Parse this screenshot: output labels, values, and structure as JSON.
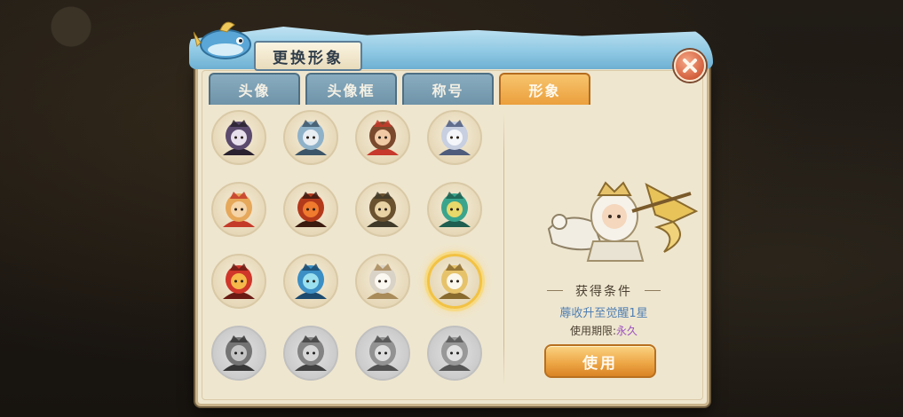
{
  "dialog": {
    "title": "更换形象"
  },
  "tabs": [
    {
      "label": "头像",
      "active": false
    },
    {
      "label": "头像框",
      "active": false
    },
    {
      "label": "称号",
      "active": false
    },
    {
      "label": "形象",
      "active": true
    }
  ],
  "avatars": [
    {
      "icon": "hero-dark-bearded-icon",
      "palette": [
        "#5b4a6e",
        "#e8e0ec",
        "#2a2230"
      ],
      "state": "unlocked"
    },
    {
      "icon": "hero-silver-armored-icon",
      "palette": [
        "#8fb2c9",
        "#e9eef3",
        "#3d5568"
      ],
      "state": "unlocked"
    },
    {
      "icon": "hero-fox-ear-girl-icon",
      "palette": [
        "#7b4a2e",
        "#f2c9a5",
        "#c7392c"
      ],
      "state": "unlocked"
    },
    {
      "icon": "hero-white-hair-icon",
      "palette": [
        "#c7cfe0",
        "#f4f6fa",
        "#4f5c7c"
      ],
      "state": "unlocked"
    },
    {
      "icon": "hero-monk-icon",
      "palette": [
        "#e6a85a",
        "#f4d4a8",
        "#c43b2a"
      ],
      "state": "unlocked"
    },
    {
      "icon": "hero-fire-beast-icon",
      "palette": [
        "#b43a1c",
        "#f07a2e",
        "#3b1a10"
      ],
      "state": "unlocked"
    },
    {
      "icon": "hero-horned-warrior-icon",
      "palette": [
        "#6a5230",
        "#e8d2a4",
        "#3f3a2a"
      ],
      "state": "unlocked"
    },
    {
      "icon": "hero-green-dragon-icon",
      "palette": [
        "#3aa58c",
        "#e9d86a",
        "#1f5e50"
      ],
      "state": "unlocked"
    },
    {
      "icon": "hero-red-dragon-icon",
      "palette": [
        "#d0362a",
        "#f5b84a",
        "#6a1c14"
      ],
      "state": "unlocked"
    },
    {
      "icon": "hero-azure-dragon-icon",
      "palette": [
        "#3b8fc4",
        "#9be0ef",
        "#1c4a6e"
      ],
      "state": "unlocked"
    },
    {
      "icon": "hero-white-fox-icon",
      "palette": [
        "#d9d2c6",
        "#fbf8f2",
        "#a98b5a"
      ],
      "state": "unlocked"
    },
    {
      "icon": "hero-golden-crown-icon",
      "palette": [
        "#e6c36a",
        "#fbf7ec",
        "#8a6b2e"
      ],
      "state": "selected"
    },
    {
      "icon": "hero-armored-general-icon",
      "palette": [
        "#7a7a7a",
        "#cfcfcf",
        "#3a3a3a"
      ],
      "state": "locked"
    },
    {
      "icon": "hero-long-hair-icon",
      "palette": [
        "#8a8a8a",
        "#e2e2e2",
        "#444444"
      ],
      "state": "locked"
    },
    {
      "icon": "hero-twin-tail-icon",
      "palette": [
        "#9a9a9a",
        "#eaeaea",
        "#555555"
      ],
      "state": "locked"
    },
    {
      "icon": "hero-wild-mane-icon",
      "palette": [
        "#a0a0a0",
        "#ededed",
        "#5a5a5a"
      ],
      "state": "locked"
    }
  ],
  "preview": {
    "icon": "hero-golden-crown-full-figure-icon",
    "condition_title": "获得条件",
    "condition_text": "蓐收升至觉醒1星",
    "period_label": "使用期限:",
    "period_value": "永久",
    "use_button": "使用"
  },
  "colors": {
    "tab_active": "#eb9f3c",
    "tab_inactive": "#6f93a8",
    "condition_blue": "#4f7fb3",
    "period_purple": "#9b4fc0",
    "selected_glow": "#f2c243"
  }
}
